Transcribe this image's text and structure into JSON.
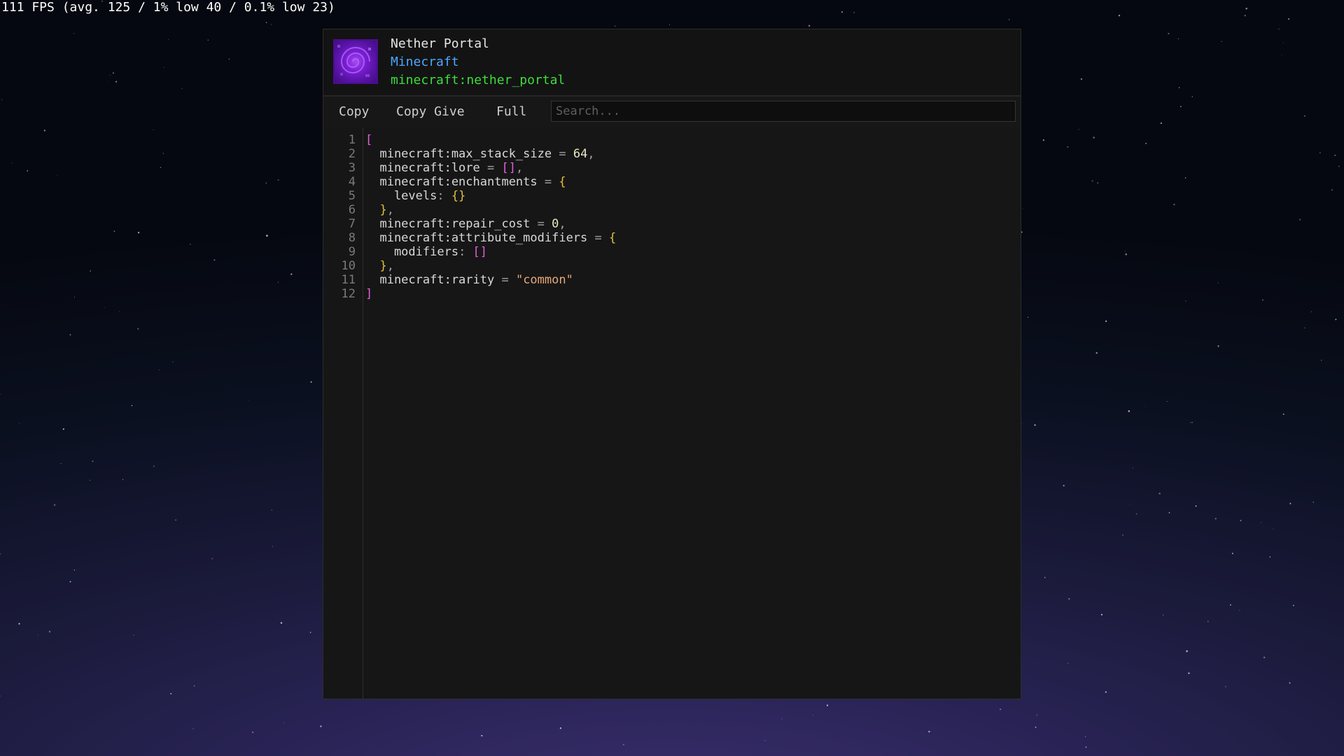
{
  "overlay": {
    "fps_text": "111 FPS (avg. 125 / 1% low 40 / 0.1% low 23)"
  },
  "item": {
    "name": "Nether Portal",
    "mod": "Minecraft",
    "id": "minecraft:nether_portal",
    "icon": "nether-portal-block-icon"
  },
  "toolbar": {
    "copy_label": "Copy",
    "copy_give_label": "Copy Give",
    "full_label": "Full",
    "search_placeholder": "Search...",
    "search_value": ""
  },
  "editor": {
    "line_numbers": [
      "1",
      "2",
      "3",
      "4",
      "5",
      "6",
      "7",
      "8",
      "9",
      "10",
      "11",
      "12"
    ],
    "lines": [
      [
        {
          "t": "[",
          "c": "tok-br-pink"
        }
      ],
      [
        {
          "t": "  minecraft:max_stack_size",
          "c": "tok-key"
        },
        {
          "t": " = ",
          "c": "tok-op"
        },
        {
          "t": "64",
          "c": "tok-num"
        },
        {
          "t": ",",
          "c": "tok-op"
        }
      ],
      [
        {
          "t": "  minecraft:lore",
          "c": "tok-key"
        },
        {
          "t": " = ",
          "c": "tok-op"
        },
        {
          "t": "[]",
          "c": "tok-br-pink"
        },
        {
          "t": ",",
          "c": "tok-op"
        }
      ],
      [
        {
          "t": "  minecraft:enchantments",
          "c": "tok-key"
        },
        {
          "t": " = ",
          "c": "tok-op"
        },
        {
          "t": "{",
          "c": "tok-br-yellow"
        }
      ],
      [
        {
          "t": "    levels",
          "c": "tok-key"
        },
        {
          "t": ": ",
          "c": "tok-op"
        },
        {
          "t": "{}",
          "c": "tok-br-yellow"
        }
      ],
      [
        {
          "t": "  }",
          "c": "tok-br-yellow"
        },
        {
          "t": ",",
          "c": "tok-op"
        }
      ],
      [
        {
          "t": "  minecraft:repair_cost",
          "c": "tok-key"
        },
        {
          "t": " = ",
          "c": "tok-op"
        },
        {
          "t": "0",
          "c": "tok-num"
        },
        {
          "t": ",",
          "c": "tok-op"
        }
      ],
      [
        {
          "t": "  minecraft:attribute_modifiers",
          "c": "tok-key"
        },
        {
          "t": " = ",
          "c": "tok-op"
        },
        {
          "t": "{",
          "c": "tok-br-yellow"
        }
      ],
      [
        {
          "t": "    modifiers",
          "c": "tok-key"
        },
        {
          "t": ": ",
          "c": "tok-op"
        },
        {
          "t": "[]",
          "c": "tok-br-pink"
        }
      ],
      [
        {
          "t": "  }",
          "c": "tok-br-yellow"
        },
        {
          "t": ",",
          "c": "tok-op"
        }
      ],
      [
        {
          "t": "  minecraft:rarity",
          "c": "tok-key"
        },
        {
          "t": " = ",
          "c": "tok-op"
        },
        {
          "t": "\"common\"",
          "c": "tok-str"
        }
      ],
      [
        {
          "t": "]",
          "c": "tok-br-pink"
        }
      ]
    ]
  },
  "colors": {
    "panel_bg": "#141414",
    "mod_name": "#4da6ff",
    "item_id": "#3ddc3d",
    "bracket_pink": "#e060d8",
    "bracket_yellow": "#e0c040",
    "string": "#e8a878"
  }
}
